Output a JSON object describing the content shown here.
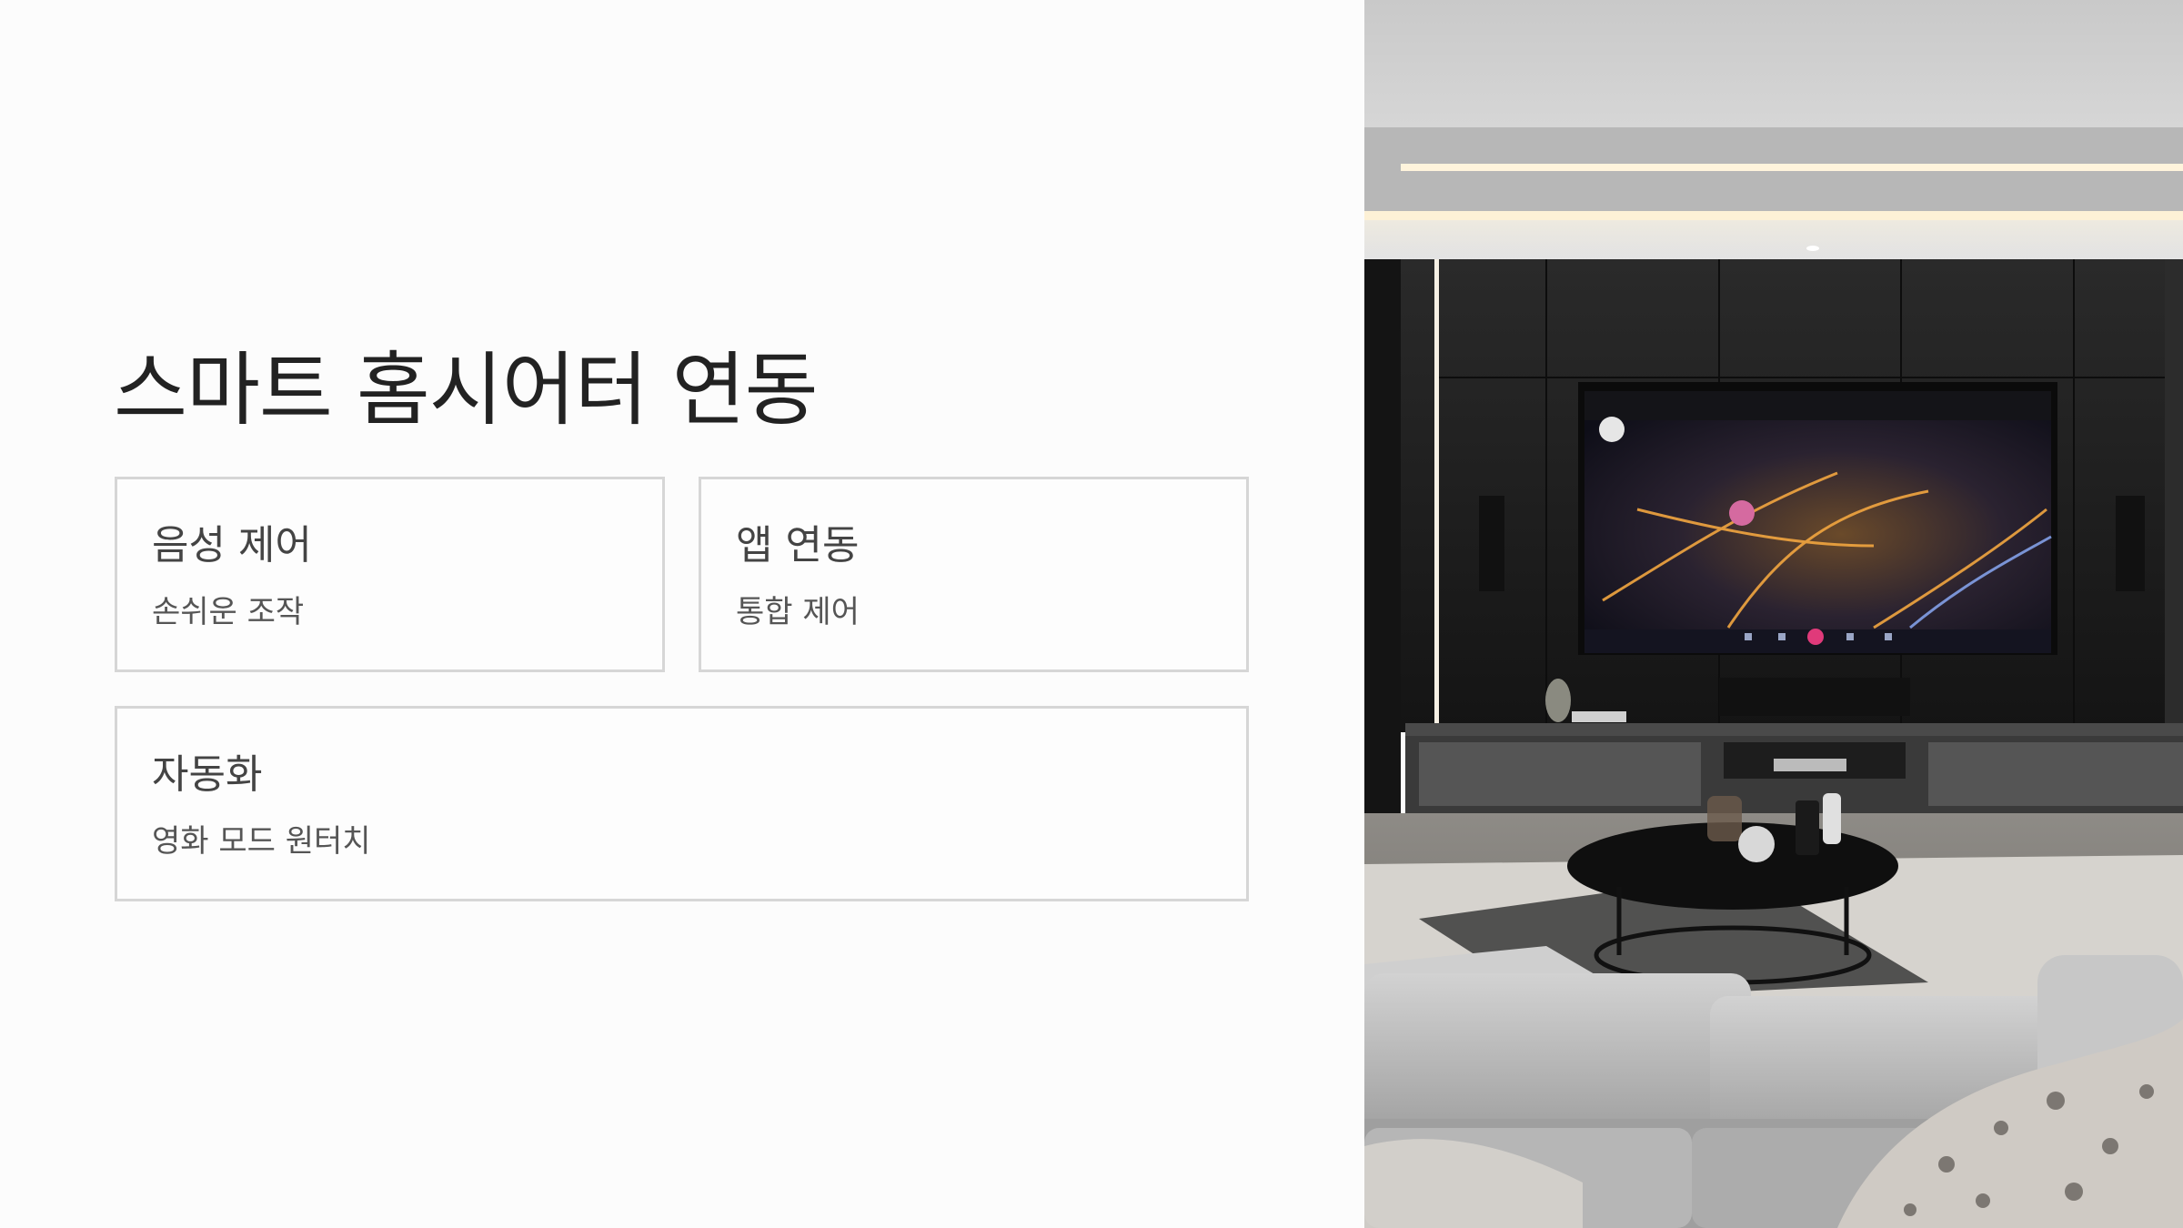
{
  "slide": {
    "title": "스마트 홈시어터 연동",
    "cards": [
      {
        "title": "음성 제어",
        "subtitle": "손쉬운 조작"
      },
      {
        "title": "앱 연동",
        "subtitle": "통합 제어"
      },
      {
        "title": "자동화",
        "subtitle": "영화 모드 원터치"
      }
    ]
  },
  "image": {
    "subject": "home-theater-living-room",
    "colors": {
      "wall": "#1c1c1c",
      "ceiling": "#cfcfcf",
      "sofa": "#b9b9b9",
      "screen_glow": "#f4a340"
    }
  }
}
